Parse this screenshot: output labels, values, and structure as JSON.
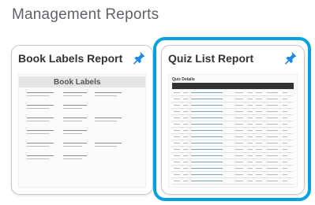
{
  "page": {
    "title": "Management Reports"
  },
  "cards": [
    {
      "title": "Book Labels Report",
      "pin_icon": "pushpin-icon",
      "thumbnail": {
        "heading": "Book Labels"
      }
    },
    {
      "title": "Quiz List Report",
      "pin_icon": "pushpin-icon",
      "selected": true,
      "thumbnail": {
        "caption": "Quiz Details"
      }
    }
  ],
  "colors": {
    "accent": "#00a3e0",
    "pin": "#1e88e5",
    "title_text": "#5f6368"
  }
}
